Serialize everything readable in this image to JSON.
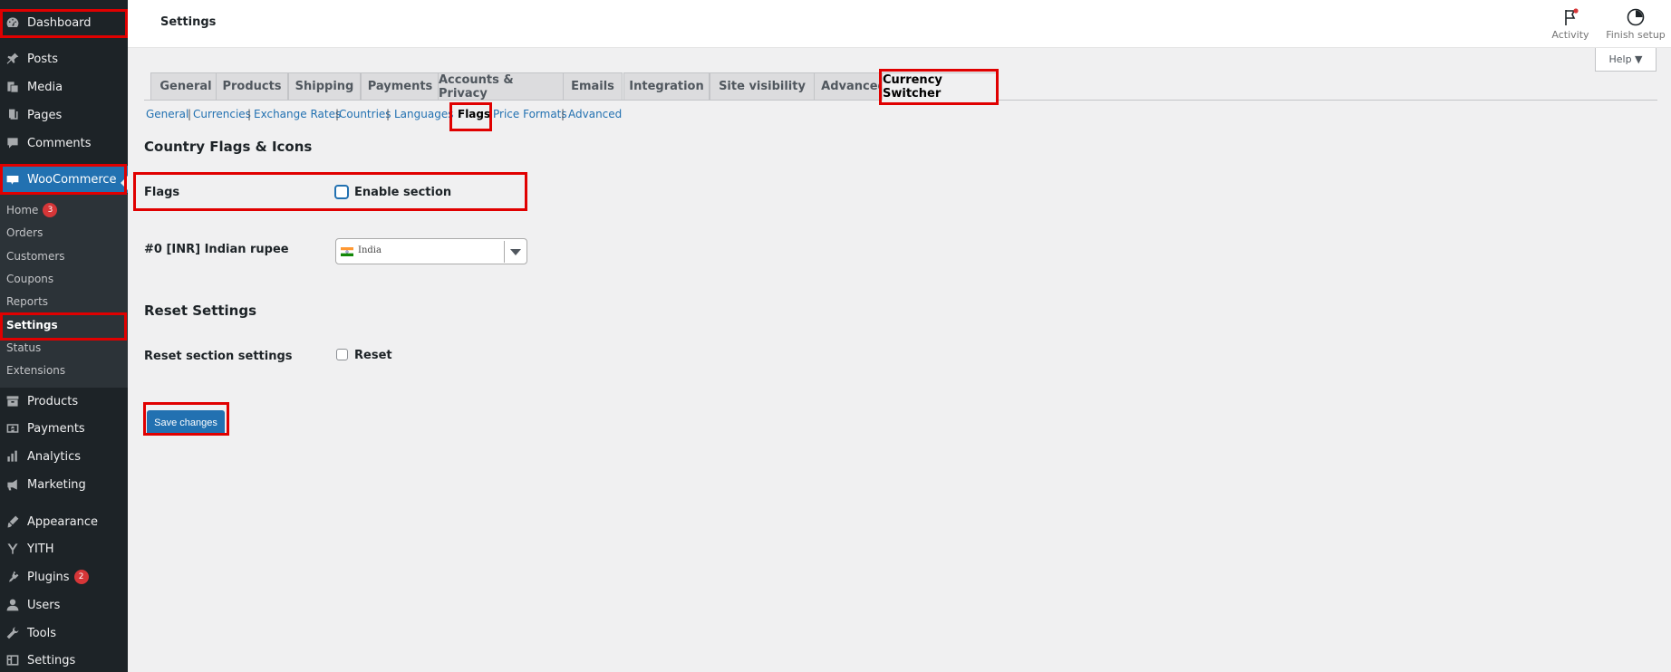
{
  "sidebar": {
    "items": [
      {
        "label": "Dashboard",
        "icon": "dashboard-icon"
      },
      {
        "label": "Posts",
        "icon": "pin-icon"
      },
      {
        "label": "Media",
        "icon": "media-icon"
      },
      {
        "label": "Pages",
        "icon": "pages-icon"
      },
      {
        "label": "Comments",
        "icon": "comment-icon"
      },
      {
        "label": "WooCommerce",
        "icon": "woocommerce-icon"
      },
      {
        "label": "Products",
        "icon": "archive-icon"
      },
      {
        "label": "Payments",
        "icon": "dollar-icon"
      },
      {
        "label": "Analytics",
        "icon": "bar-chart-icon"
      },
      {
        "label": "Marketing",
        "icon": "megaphone-icon"
      },
      {
        "label": "Appearance",
        "icon": "brush-icon"
      },
      {
        "label": "YITH",
        "icon": "yith-icon"
      },
      {
        "label": "Plugins",
        "icon": "plug-icon",
        "badge": "2"
      },
      {
        "label": "Users",
        "icon": "user-icon"
      },
      {
        "label": "Tools",
        "icon": "wrench-icon"
      },
      {
        "label": "Settings",
        "icon": "settings-icon"
      }
    ],
    "woocommerce_submenu": [
      {
        "label": "Home",
        "badge": "3"
      },
      {
        "label": "Orders"
      },
      {
        "label": "Customers"
      },
      {
        "label": "Coupons"
      },
      {
        "label": "Reports"
      },
      {
        "label": "Settings"
      },
      {
        "label": "Status"
      },
      {
        "label": "Extensions"
      }
    ]
  },
  "header": {
    "title": "Settings",
    "activity_label": "Activity",
    "finish_setup_label": "Finish setup",
    "help_label": "Help ▼"
  },
  "tabs": [
    "General",
    "Products",
    "Shipping",
    "Payments",
    "Accounts & Privacy",
    "Emails",
    "Integration",
    "Site visibility",
    "Advanced",
    "Currency Switcher"
  ],
  "active_tab": "Currency Switcher",
  "subnav": [
    "General",
    "Currencies",
    "Exchange Rates",
    "Countries",
    "Languages",
    "Flags",
    "Price Formats",
    "Advanced"
  ],
  "active_subnav": "Flags",
  "flags_section": {
    "title": "Country Flags & Icons",
    "flags_label": "Flags",
    "enable_label": "Enable section",
    "enabled": false,
    "currency_row_label": "#0 [INR] Indian rupee",
    "currency_select_value": "India"
  },
  "reset_section": {
    "title": "Reset Settings",
    "row_label": "Reset section settings",
    "reset_label": "Reset",
    "checked": false
  },
  "save_label": "Save changes",
  "colors": {
    "accent": "#2271b1",
    "highlight": "#e00000",
    "sidebar_bg": "#1d2327"
  }
}
